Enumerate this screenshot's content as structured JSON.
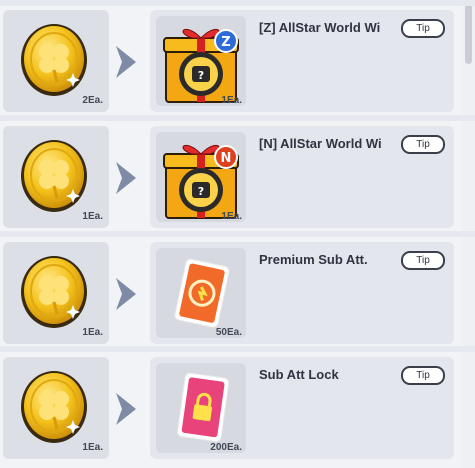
{
  "rows": [
    {
      "cost": {
        "icon": "gold-clover-coin-icon",
        "qty": "2Ea."
      },
      "reward": {
        "icon": "z-allstar-gift-box-icon",
        "qty": "1Ea.",
        "title": "[Z] AllStar World Wi",
        "tip_label": "Tip"
      }
    },
    {
      "cost": {
        "icon": "gold-clover-coin-icon",
        "qty": "1Ea."
      },
      "reward": {
        "icon": "n-allstar-gift-box-icon",
        "qty": "1Ea.",
        "title": "[N] AllStar World Wi",
        "tip_label": "Tip"
      }
    },
    {
      "cost": {
        "icon": "gold-clover-coin-icon",
        "qty": "1Ea."
      },
      "reward": {
        "icon": "premium-sub-att-card-icon",
        "qty": "50Ea.",
        "title": "Premium Sub Att.",
        "tip_label": "Tip"
      }
    },
    {
      "cost": {
        "icon": "gold-clover-coin-icon",
        "qty": "1Ea."
      },
      "reward": {
        "icon": "sub-att-lock-card-icon",
        "qty": "200Ea.",
        "title": "Sub Att Lock",
        "tip_label": "Tip"
      }
    }
  ],
  "colors": {
    "background": "#f2f3f7",
    "panel": "#e3e6ec",
    "arrow": "#7e8aa6",
    "coin_gold": "#f2c21a",
    "z_badge": "#2f6bd8",
    "n_badge": "#e0401e",
    "card_orange": "#f26a2a",
    "card_pink": "#e8437a"
  }
}
